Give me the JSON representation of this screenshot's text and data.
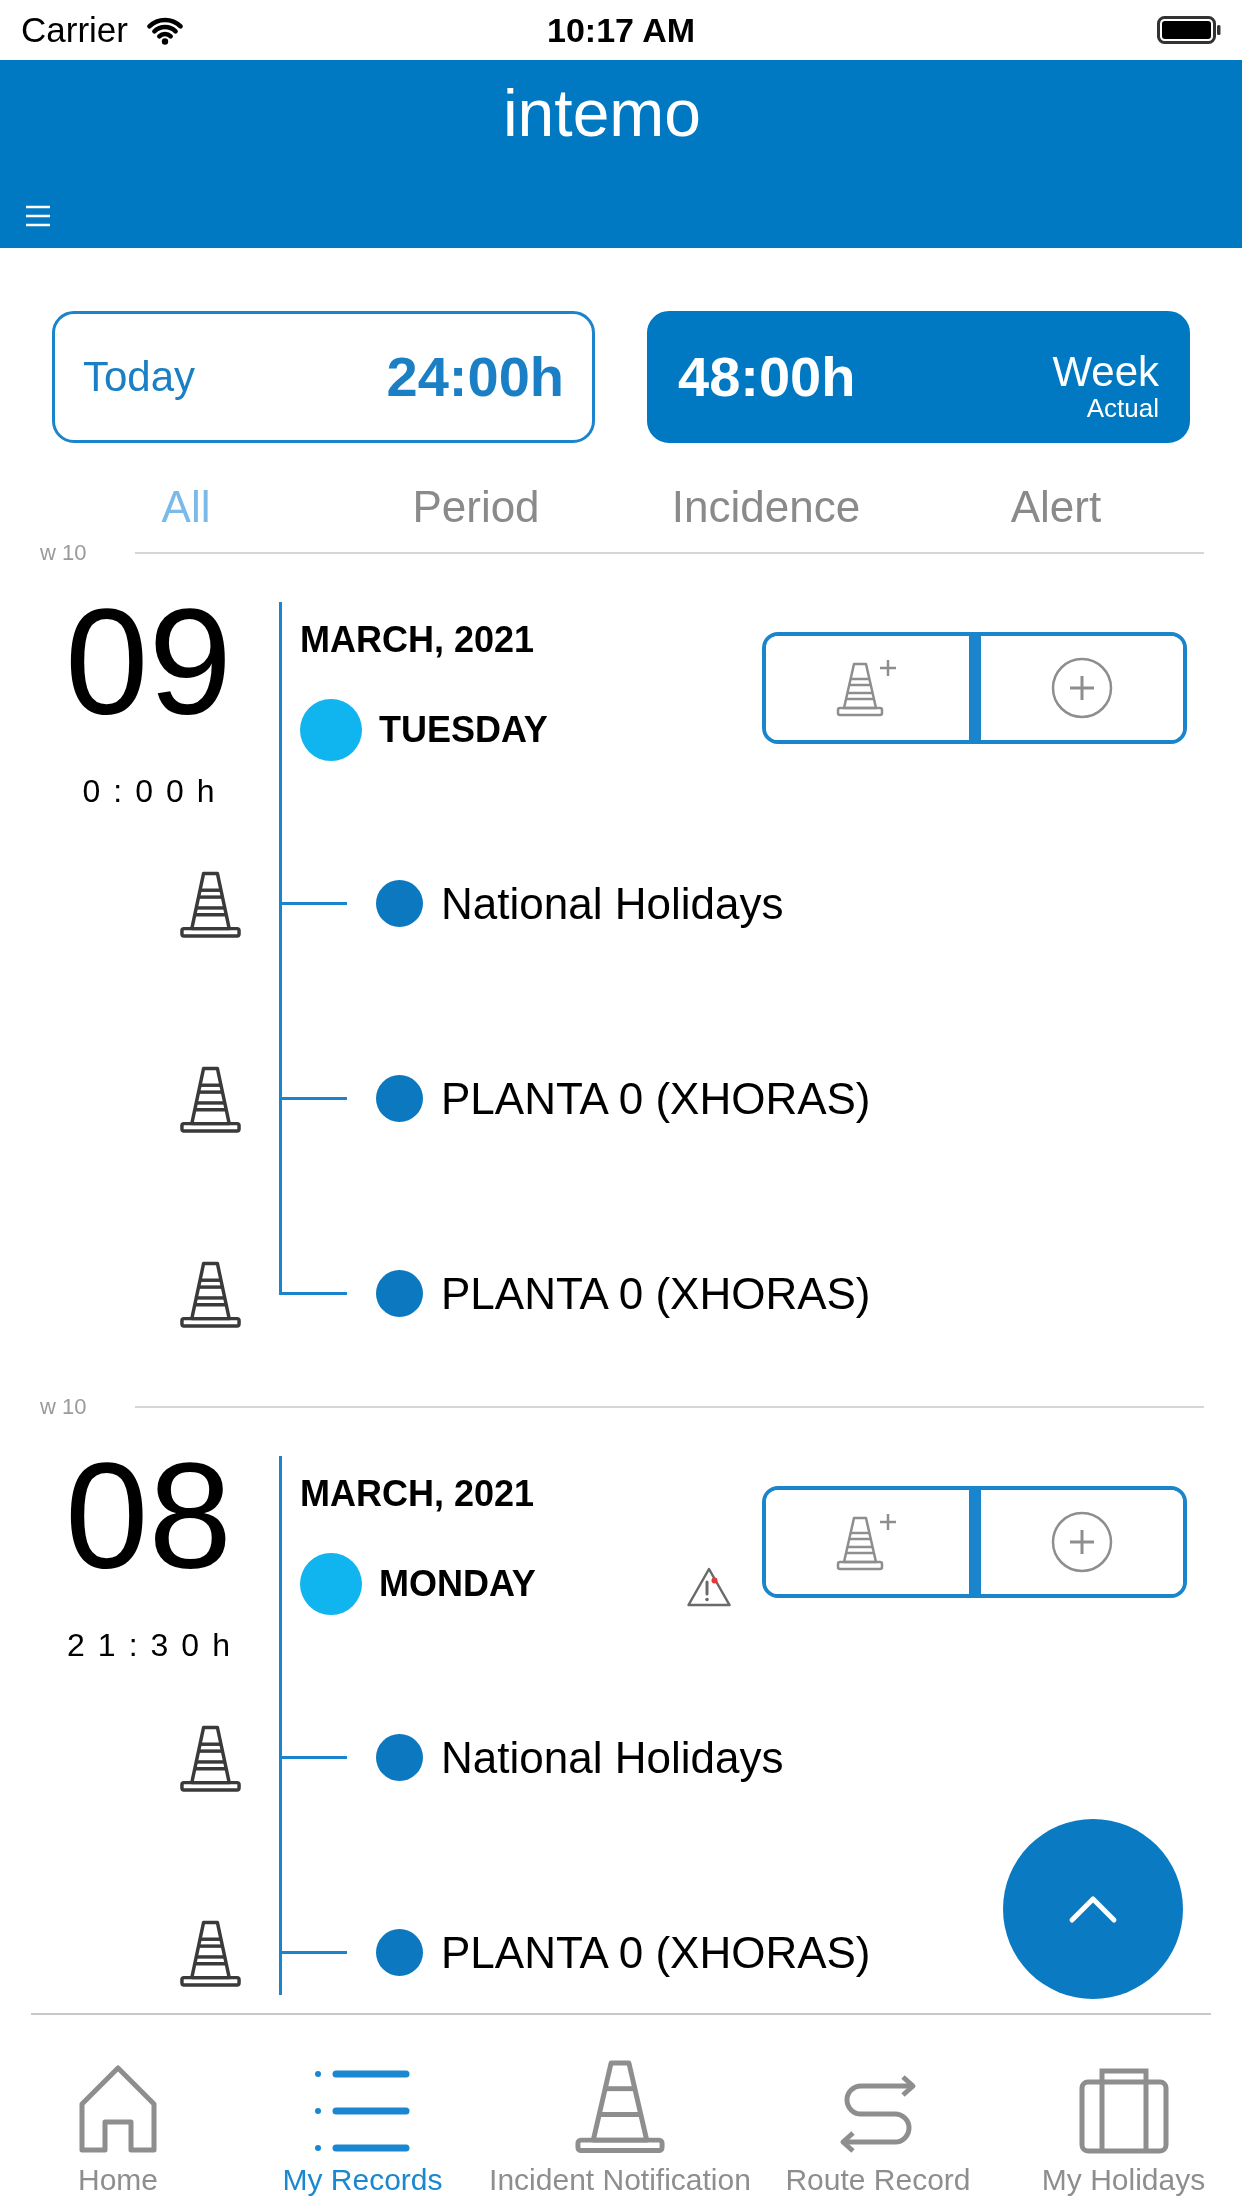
{
  "status_bar": {
    "carrier": "Carrier",
    "time": "10:17 AM"
  },
  "header": {
    "logo": "intemo"
  },
  "summary": [
    {
      "kind": "today",
      "period": "Today",
      "hours": "24:00h",
      "selected": false
    },
    {
      "kind": "week",
      "hours": "48:00h",
      "period": "Week",
      "note": "Actual",
      "selected": true
    }
  ],
  "filters": [
    {
      "label": "All",
      "selected": true
    },
    {
      "label": "Period",
      "selected": false
    },
    {
      "label": "Incidence",
      "selected": false
    },
    {
      "label": "Alert",
      "selected": false
    }
  ],
  "days": [
    {
      "week": "w 10",
      "day": "09",
      "total": "0:00h",
      "month": "MARCH, 2021",
      "weekday": "TUESDAY",
      "alert": false,
      "continues_below": false,
      "entries": [
        {
          "label": "National Holidays"
        },
        {
          "label": "PLANTA 0 (XHORAS)"
        },
        {
          "label": "PLANTA 0 (XHORAS)"
        }
      ]
    },
    {
      "week": "w 10",
      "day": "08",
      "total": "21:30h",
      "month": "MARCH, 2021",
      "weekday": "MONDAY",
      "alert": true,
      "continues_below": true,
      "entries": [
        {
          "label": "National Holidays"
        },
        {
          "label": "PLANTA 0 (XHORAS)"
        }
      ]
    }
  ],
  "bottom_nav": [
    {
      "label": "Home",
      "selected": false
    },
    {
      "label": "My Records",
      "selected": true
    },
    {
      "label": "Incident Notification",
      "selected": false
    },
    {
      "label": "Route Record",
      "selected": false
    },
    {
      "label": "My Holidays",
      "selected": false
    }
  ]
}
